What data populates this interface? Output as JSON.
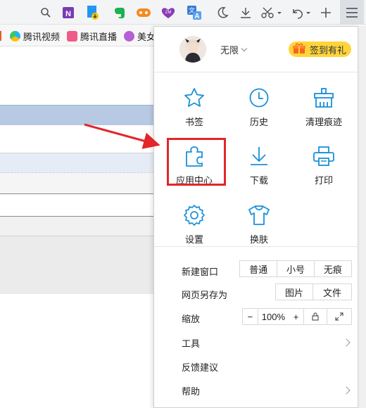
{
  "toolbar": {
    "icons": [
      "search-icon",
      "onenote-icon",
      "save-download-icon",
      "evernote-icon",
      "game-icon",
      "zoom-app-icon",
      "translate-icon",
      "night-mode-icon",
      "download-icon",
      "cut-icon",
      "undo-icon",
      "new-tab-icon",
      "menu-icon"
    ]
  },
  "bookmarks": [
    {
      "label": "腾讯视频",
      "icon": "tencent-video-icon",
      "color": "#20b4f5"
    },
    {
      "label": "腾讯直播",
      "icon": "tencent-live-icon",
      "color": "#f05a8a"
    },
    {
      "label": "美女",
      "icon": "beauty-icon",
      "color": "#b55fd6"
    }
  ],
  "menu": {
    "user": {
      "name": "无限",
      "avatar": "user-avatar"
    },
    "signin_label": "签到有礼",
    "grid": [
      {
        "label": "书签",
        "icon": "star-icon"
      },
      {
        "label": "历史",
        "icon": "clock-icon"
      },
      {
        "label": "清理痕迹",
        "icon": "broom-icon"
      },
      {
        "label": "应用中心",
        "icon": "puzzle-icon"
      },
      {
        "label": "下载",
        "icon": "download-icon"
      },
      {
        "label": "打印",
        "icon": "printer-icon"
      },
      {
        "label": "设置",
        "icon": "gear-icon"
      },
      {
        "label": "换肤",
        "icon": "tshirt-icon"
      }
    ],
    "new_window": {
      "label": "新建窗口",
      "options": [
        "普通",
        "小号",
        "无痕"
      ]
    },
    "save_as": {
      "label": "网页另存为",
      "options": [
        "图片",
        "文件"
      ]
    },
    "zoom": {
      "label": "缩放",
      "minus": "−",
      "value": "100%",
      "plus": "+"
    },
    "tools_label": "工具",
    "feedback_label": "反馈建议",
    "help_label": "帮助"
  },
  "colors": {
    "accent": "#1a90d8",
    "highlight": "#e2262a",
    "signin": "#ffd43b"
  }
}
